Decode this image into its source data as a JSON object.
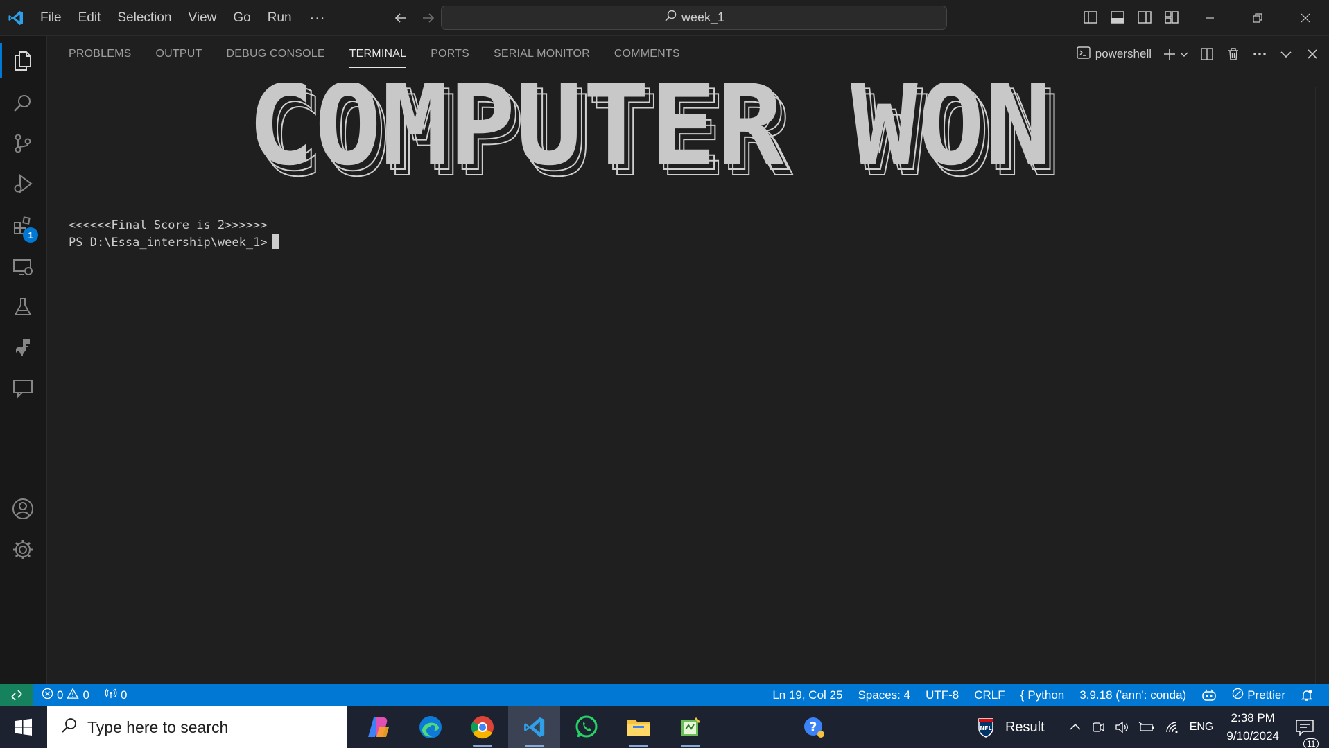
{
  "window": {
    "menu": [
      "File",
      "Edit",
      "Selection",
      "View",
      "Go",
      "Run"
    ],
    "menu_more": "···",
    "search_text": "week_1"
  },
  "activity_bar": {
    "extensions_badge": "1"
  },
  "panel": {
    "tabs": [
      "PROBLEMS",
      "OUTPUT",
      "DEBUG CONSOLE",
      "TERMINAL",
      "PORTS",
      "SERIAL MONITOR",
      "COMMENTS"
    ],
    "active_tab": "TERMINAL",
    "shell_label": "powershell"
  },
  "terminal": {
    "banner_text": "COMPUTER WON",
    "line1": "<<<<<<Final Score is 2>>>>>>",
    "prompt": "PS D:\\Essa_intership\\week_1>"
  },
  "status_bar": {
    "errors": "0",
    "warnings": "0",
    "ports": "0",
    "position": "Ln 19, Col 25",
    "spaces": "Spaces: 4",
    "encoding": "UTF-8",
    "eol": "CRLF",
    "language": "Python",
    "interpreter": "3.9.18 ('ann': conda)",
    "formatter": "Prettier"
  },
  "taskbar": {
    "search_placeholder": "Type here to search",
    "news_label": "Result",
    "lang": "ENG",
    "time": "2:38 PM",
    "date": "9/10/2024",
    "notifications": "11"
  }
}
